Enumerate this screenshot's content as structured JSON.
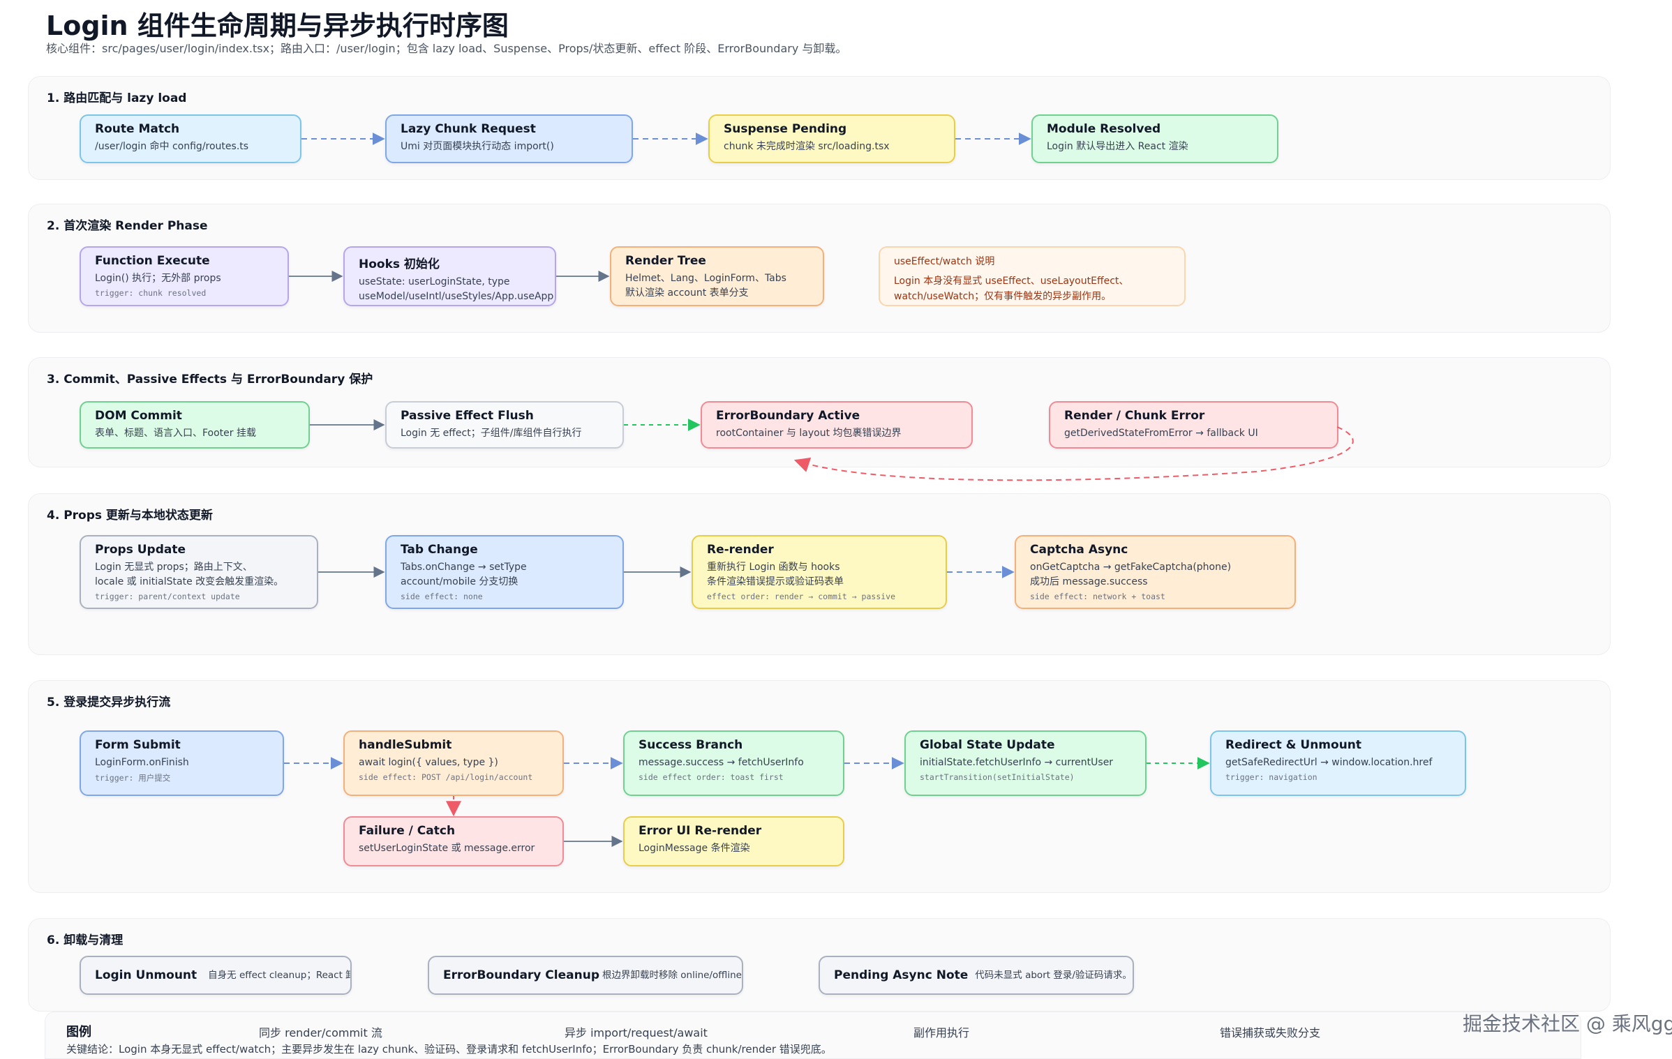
{
  "header": {
    "title": "Login 组件生命周期与异步执行时序图",
    "subtitle": "核心组件：src/pages/user/login/index.tsx；路由入口：/user/login；包含 lazy load、Suspense、Props/状态更新、effect 阶段、ErrorBoundary 与卸载。"
  },
  "sections": [
    {
      "title": "1. 路由匹配与 lazy load",
      "nodes": [
        {
          "title": "Route Match",
          "desc": "/user/login 命中 config/routes.ts"
        },
        {
          "title": "Lazy Chunk Request",
          "desc": "Umi 对页面模块执行动态 import()"
        },
        {
          "title": "Suspense Pending",
          "desc": "chunk 未完成时渲染 src/loading.tsx"
        },
        {
          "title": "Module Resolved",
          "desc": "Login 默认导出进入 React 渲染"
        }
      ]
    },
    {
      "title": "2. 首次渲染 Render Phase",
      "nodes": [
        {
          "title": "Function Execute",
          "desc": "Login() 执行；无外部 props",
          "extra": "trigger: chunk resolved"
        },
        {
          "title": "Hooks 初始化",
          "desc": "useState: userLoginState, type",
          "desc2": "useModel/useIntl/useStyles/App.useApp"
        },
        {
          "title": "Render Tree",
          "desc": "Helmet、Lang、LoginForm、Tabs",
          "desc2": "默认渲染 account 表单分支"
        }
      ],
      "note": {
        "title": "useEffect/watch 说明",
        "line1": "Login 本身没有显式 useEffect、useLayoutEffect、",
        "line2": "watch/useWatch；仅有事件触发的异步副作用。"
      }
    },
    {
      "title": "3. Commit、Passive Effects 与 ErrorBoundary 保护",
      "nodes": [
        {
          "title": "DOM Commit",
          "desc": "表单、标题、语言入口、Footer 挂载"
        },
        {
          "title": "Passive Effect Flush",
          "desc": "Login 无 effect；子组件/库组件自行执行"
        },
        {
          "title": "ErrorBoundary Active",
          "desc": "rootContainer 与 layout 均包裹错误边界"
        },
        {
          "title": "Render / Chunk Error",
          "desc": "getDerivedStateFromError → fallback UI"
        }
      ]
    },
    {
      "title": "4. Props 更新与本地状态更新",
      "nodes": [
        {
          "title": "Props Update",
          "desc": "Login 无显式 props；路由上下文、",
          "desc2": "locale 或 initialState 改变会触发重渲染。",
          "extra": "trigger: parent/context update"
        },
        {
          "title": "Tab Change",
          "desc": "Tabs.onChange → setType",
          "desc2": "account/mobile 分支切换",
          "extra": "side effect: none"
        },
        {
          "title": "Re-render",
          "desc": "重新执行 Login 函数与 hooks",
          "desc2": "条件渲染错误提示或验证码表单",
          "extra": "effect order: render → commit → passive"
        },
        {
          "title": "Captcha Async",
          "desc": "onGetCaptcha → getFakeCaptcha(phone)",
          "desc2": "成功后 message.success",
          "extra": "side effect: network + toast"
        }
      ]
    },
    {
      "title": "5. 登录提交异步执行流",
      "nodes": [
        {
          "title": "Form Submit",
          "desc": "LoginForm.onFinish",
          "extra": "trigger: 用户提交"
        },
        {
          "title": "handleSubmit",
          "desc": "await login({ values, type })",
          "extra": "side effect: POST /api/login/account"
        },
        {
          "title": "Success Branch",
          "desc": "message.success → fetchUserInfo",
          "extra": "side effect order: toast first"
        },
        {
          "title": "Global State Update",
          "desc": "initialState.fetchUserInfo → currentUser",
          "extra": "startTransition(setInitialState)"
        },
        {
          "title": "Redirect & Unmount",
          "desc": "getSafeRedirectUrl → window.location.href",
          "extra": "trigger: navigation"
        },
        {
          "title": "Failure / Catch",
          "desc": "setUserLoginState 或 message.error"
        },
        {
          "title": "Error UI Re-render",
          "desc": "LoginMessage 条件渲染"
        }
      ]
    },
    {
      "title": "6. 卸载与清理",
      "nodes": [
        {
          "title": "Login Unmount",
          "desc": "自身无 effect cleanup；React 卸载表单子树。"
        },
        {
          "title": "ErrorBoundary Cleanup",
          "desc": "根边界卸载时移除 online/offline listeners。"
        },
        {
          "title": "Pending Async Note",
          "desc": "代码未显式 abort 登录/验证码请求。"
        }
      ]
    }
  ],
  "legend": {
    "title": "图例",
    "items": [
      {
        "label": "同步 render/commit 流",
        "color": "#64748b"
      },
      {
        "label": "异步 import/request/await",
        "color": "#6b8fd6"
      },
      {
        "label": "副作用执行",
        "color": "#22c55e"
      },
      {
        "label": "错误捕获或失败分支",
        "color": "#ef5a67"
      }
    ],
    "conclusion": "关键结论：Login 本身无显式 effect/watch；主要异步发生在 lazy chunk、验证码、登录请求和 fetchUserInfo；ErrorBoundary 负责 chunk/render 错误兜底。"
  },
  "watermark": "掘金技术社区 @ 乘风gg"
}
